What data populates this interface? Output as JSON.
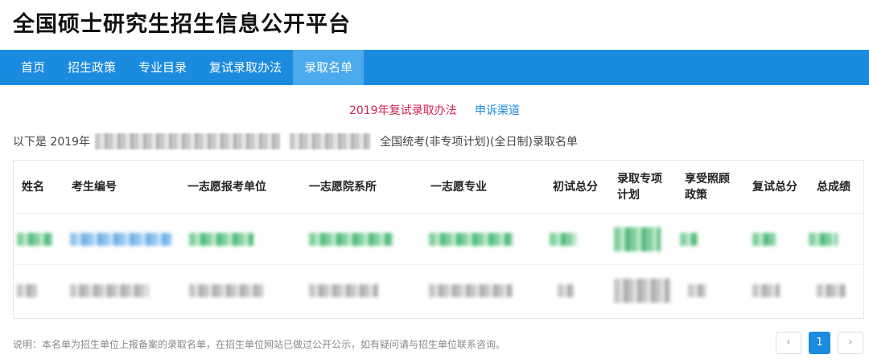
{
  "site": {
    "title": "全国硕士研究生招生信息公开平台"
  },
  "nav": {
    "items": [
      {
        "label": "首页",
        "active": false
      },
      {
        "label": "招生政策",
        "active": false
      },
      {
        "label": "专业目录",
        "active": false
      },
      {
        "label": "复试录取办法",
        "active": false
      },
      {
        "label": "录取名单",
        "active": true
      }
    ]
  },
  "links": {
    "review_method": "2019年复试录取办法",
    "appeal": "申诉渠道"
  },
  "intro": {
    "prefix": "以下是 2019年",
    "suffix": "全国统考(非专项计划)(全日制)录取名单"
  },
  "table": {
    "headers": [
      "姓名",
      "考生编号",
      "一志愿报考单位",
      "一志愿院系所",
      "一志愿专业",
      "初试总分",
      "录取专项计划",
      "享受照顾政策",
      "复试总分",
      "总成绩"
    ],
    "rows_note": "cell values are pixelated / redacted in the screenshot"
  },
  "footer": {
    "note": "说明：本名单为招生单位上报备案的录取名单，在招生单位网站已做过公开公示，如有疑问请与招生单位联系咨询。",
    "pagination": {
      "prev": "‹",
      "current": "1",
      "next": "›"
    }
  },
  "colors": {
    "primary": "#1b8be0",
    "nav_active": "#4ba9ee",
    "accent_red": "#d6224f"
  }
}
